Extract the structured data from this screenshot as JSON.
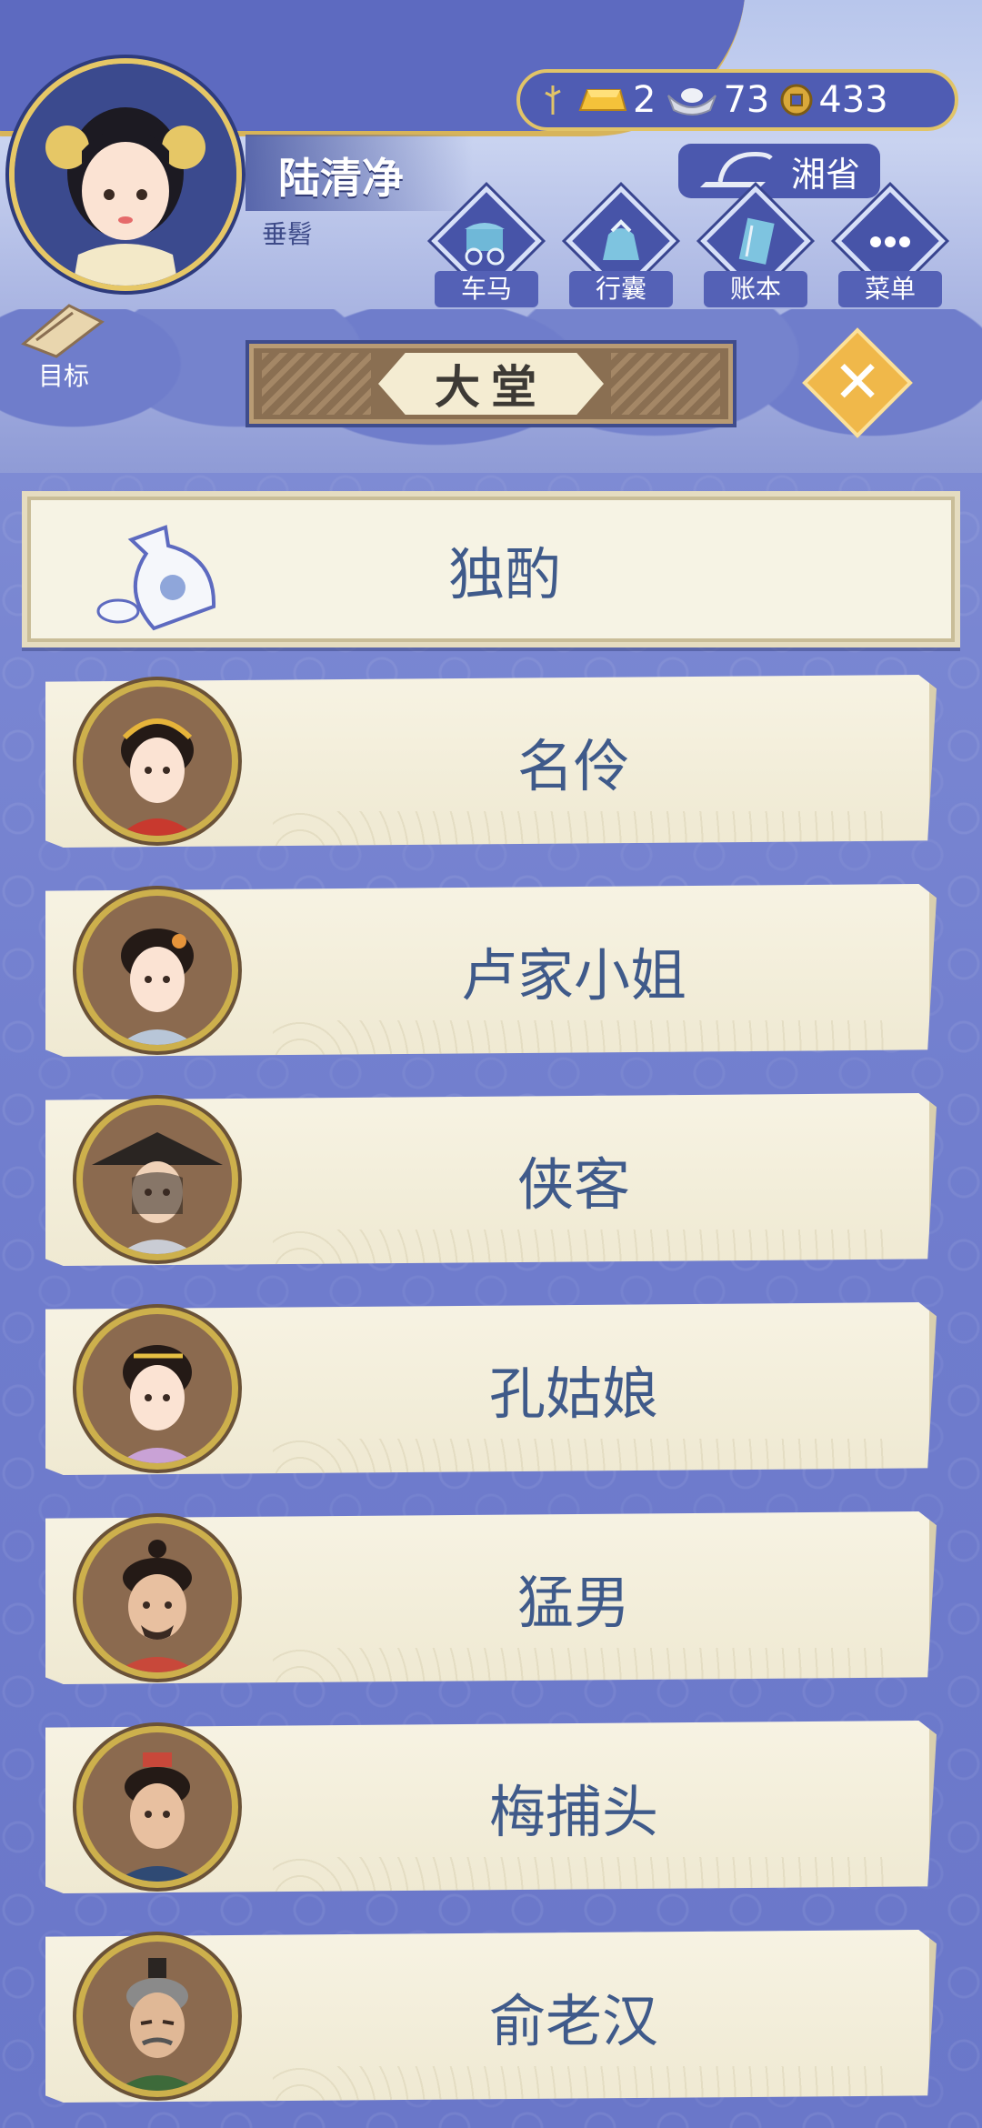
{
  "player": {
    "name": "陆清净",
    "title": "垂髫"
  },
  "currency": {
    "gold": "2",
    "silver": "73",
    "coin": "433"
  },
  "location": "湘省",
  "menu": [
    {
      "id": "carriage",
      "label": "车马"
    },
    {
      "id": "bag",
      "label": "行囊"
    },
    {
      "id": "ledger",
      "label": "账本"
    },
    {
      "id": "menu",
      "label": "菜单"
    }
  ],
  "goal_label": "目标",
  "hall_title": "大堂",
  "close_label": "✕",
  "drink_option": "独酌",
  "characters": [
    {
      "name": "名伶"
    },
    {
      "name": "卢家小姐"
    },
    {
      "name": "侠客"
    },
    {
      "name": "孔姑娘"
    },
    {
      "name": "猛男"
    },
    {
      "name": "梅捕头"
    },
    {
      "name": "俞老汉"
    }
  ],
  "colors": {
    "accent_gold": "#e1c468",
    "panel_blue": "#4f5cb3",
    "card_text": "#3f5a8a"
  }
}
